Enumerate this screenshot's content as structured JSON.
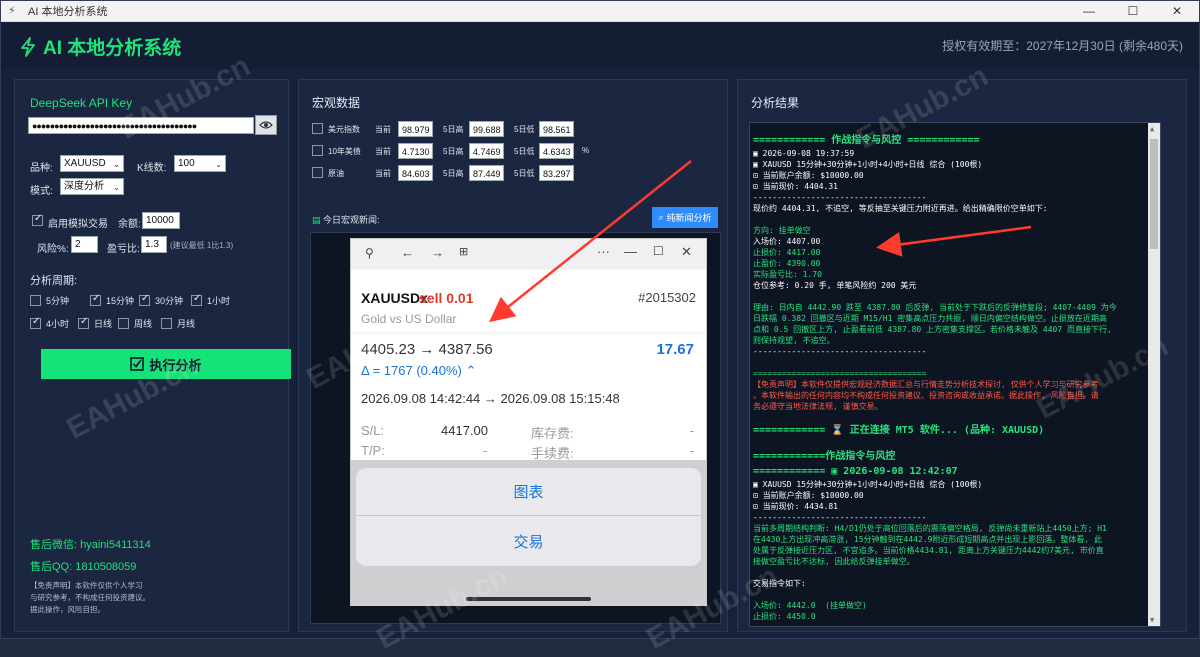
{
  "window": {
    "title": "AI 本地分析系统",
    "min": "—",
    "max": "☐",
    "close": "✕"
  },
  "header": {
    "logo_text": "AI 本地分析系统",
    "license": "授权有效期至：2027年12月30日 (剩余480天)"
  },
  "left": {
    "api_title": "DeepSeek API Key",
    "api_value": "●●●●●●●●●●●●●●●●●●●●●●●●●●●●●●●●●●●●●",
    "variety_label": "品种:",
    "variety": "XAUUSD",
    "kline_label": "K线数:",
    "kline": "100",
    "mode_label": "模式:",
    "mode": "深度分析",
    "sim_label": "启用模拟交易",
    "balance_label": "余额:",
    "balance": "10000",
    "risk_label": "风险%:",
    "risk": "2",
    "rr_label": "盈亏比:",
    "rr": "1.3",
    "rr_hint": "(建议最低 1比1.3)",
    "period_title": "分析周期:",
    "periods": [
      {
        "label": "5分钟",
        "on": false
      },
      {
        "label": "15分钟",
        "on": true
      },
      {
        "label": "30分钟",
        "on": true
      },
      {
        "label": "1小时",
        "on": true
      },
      {
        "label": "4小时",
        "on": true
      },
      {
        "label": "日线",
        "on": true
      },
      {
        "label": "周线",
        "on": false
      },
      {
        "label": "月线",
        "on": false
      }
    ],
    "exec_label": "执行分析",
    "wechat": "售后微信: hyaini5411314",
    "qq": "售后QQ: 1810508059",
    "disclaimer": [
      "【免责声明】本软件仅供个人学习",
      "与研究参考，不构成任何投资建议。",
      "据此操作，风险自担。"
    ]
  },
  "macro": {
    "title": "宏观数据",
    "rows": [
      {
        "name": "美元指数",
        "cur_l": "当前",
        "cur": "98.979",
        "hi_l": "5日高",
        "hi": "99.688",
        "lo_l": "5日低",
        "lo": "98.561",
        "unit": ""
      },
      {
        "name": "10年美债",
        "cur_l": "当前",
        "cur": "4.7130",
        "hi_l": "5日高",
        "hi": "4.7469",
        "lo_l": "5日低",
        "lo": "4.6343",
        "unit": "%"
      },
      {
        "name": "原油",
        "cur_l": "当前",
        "cur": "84.603",
        "hi_l": "5日高",
        "hi": "87.449",
        "lo_l": "5日低",
        "lo": "83.297",
        "unit": ""
      }
    ],
    "news_label": "今日宏观新闻:",
    "news_btn": "纯新闻分析"
  },
  "phone": {
    "symbol": "XAUUSDx",
    "side": "sell 0.01",
    "ticket": "#2015302",
    "desc": "Gold vs US Dollar",
    "prices": "4405.23 → 4387.56",
    "profit": "17.67",
    "delta": "Δ = 1767 (0.40%) ⌃",
    "times": "2026.09.08 14:42:44 → 2026.09.08 15:15:48",
    "sl_l": "S/L:",
    "sl": "4417.00",
    "swap_l": "库存费:",
    "swap": "-",
    "tp_l": "T/P:",
    "tp": "-",
    "fee_l": "手续费:",
    "fee": "-",
    "chart_btn": "图表",
    "trade_btn": "交易"
  },
  "result": {
    "title": "分析结果",
    "lines": [
      {
        "t": "============ 作战指令与风控 ============",
        "c": "head"
      },
      {
        "t": "▣ 2026-09-08 19:37:59",
        "c": "w"
      },
      {
        "t": "▣ XAUUSD 15分钟+30分钟+1小时+4小时+日线 综合 (100根)",
        "c": "w"
      },
      {
        "t": "⊡ 当前账户余额: $10000.00",
        "c": "w"
      },
      {
        "t": "⊡ 当前现价: 4404.31",
        "c": "w"
      },
      {
        "t": "------------------------------------",
        "c": "w"
      },
      {
        "t": "现价约 4404.31, 不追空, 等反抽至关键压力附近再进。给出精确限价空单如下:",
        "c": "w"
      },
      {
        "t": " ",
        "c": "w"
      },
      {
        "t": "方向: 挂单做空",
        "c": "g"
      },
      {
        "t": "入场价: 4407.00",
        "c": "w"
      },
      {
        "t": "止损价: 4417.00",
        "c": "g"
      },
      {
        "t": "止盈价: 4390.00",
        "c": "g"
      },
      {
        "t": "实际盈亏比: 1.70",
        "c": "g"
      },
      {
        "t": "仓位参考: 0.20 手, 单笔风险约 200 美元",
        "c": "w"
      },
      {
        "t": " ",
        "c": "w"
      },
      {
        "t": "理由: 日内自 4442.90 跌至 4387.80 后反弹, 当前处于下跌后的反弹修复段; 4407-4409 为今",
        "c": "g"
      },
      {
        "t": "日跌幅 0.382 回撤区与近期 M15/H1 密集高点压力共振, 顺日内偏空结构做空。止损放在近期高",
        "c": "g"
      },
      {
        "t": "点和 0.5 回撤区上方, 止盈看前低 4387.80 上方密集支撑区。若价格未触及 4407 而直接下行,",
        "c": "g"
      },
      {
        "t": "则保持观望, 不追空。",
        "c": "g"
      },
      {
        "t": "------------------------------------",
        "c": "w"
      },
      {
        "t": " ",
        "c": "w"
      },
      {
        "t": "====================================",
        "c": "g"
      },
      {
        "t": "【免责声明】本软件仅提供宏观经济数据汇总与行情走势分析技术探讨, 仅供个人学习与研究参考",
        "c": "r"
      },
      {
        "t": "。本软件输出的任何内容均不构成任何投资建议、投资咨询或收益承诺。据此操作, 风险自担。请",
        "c": "r"
      },
      {
        "t": "务必遵守当地法律法规, 谨慎交易。",
        "c": "r"
      },
      {
        "t": " ",
        "c": "w"
      },
      {
        "t": "============ ⌛ 正在连接 MT5 软件... (品种: XAUUSD)",
        "c": "head"
      },
      {
        "t": " ",
        "c": "w"
      },
      {
        "t": "============作战指令与风控",
        "c": "head"
      },
      {
        "t": "============ ▣ 2026-09-08 12:42:07",
        "c": "head"
      },
      {
        "t": "▣ XAUUSD 15分钟+30分钟+1小时+4小时+日线 综合 (100根)",
        "c": "w"
      },
      {
        "t": "⊡ 当前账户余额: $10000.00",
        "c": "w"
      },
      {
        "t": "⊡ 当前现价: 4434.81",
        "c": "w"
      },
      {
        "t": "------------------------------------",
        "c": "w"
      },
      {
        "t": "当前多周期结构判断: H4/D1仍处于高位回落后的震荡偏空格局, 反弹尚未重新站上4450上方; H1",
        "c": "g"
      },
      {
        "t": "在4430上方出现冲高滞涨, 15分钟触到在4442.9附近形成短期高点并出现上影回落。整体看, 此",
        "c": "g"
      },
      {
        "t": "处属于反弹接近压力区, 不宜追多。当前价格4434.81, 距离上方关键压力4442约7美元, 市价直",
        "c": "g"
      },
      {
        "t": "接做空盈亏比不达标, 因此给反弹挂单做空。",
        "c": "g"
      },
      {
        "t": " ",
        "c": "w"
      },
      {
        "t": "交易指令如下:",
        "c": "w"
      },
      {
        "t": " ",
        "c": "w"
      },
      {
        "t": "入场价: 4442.0  (挂单做空)",
        "c": "g"
      },
      {
        "t": "止损价: 4450.0",
        "c": "g"
      }
    ]
  },
  "watermark": "EAHub.cn"
}
